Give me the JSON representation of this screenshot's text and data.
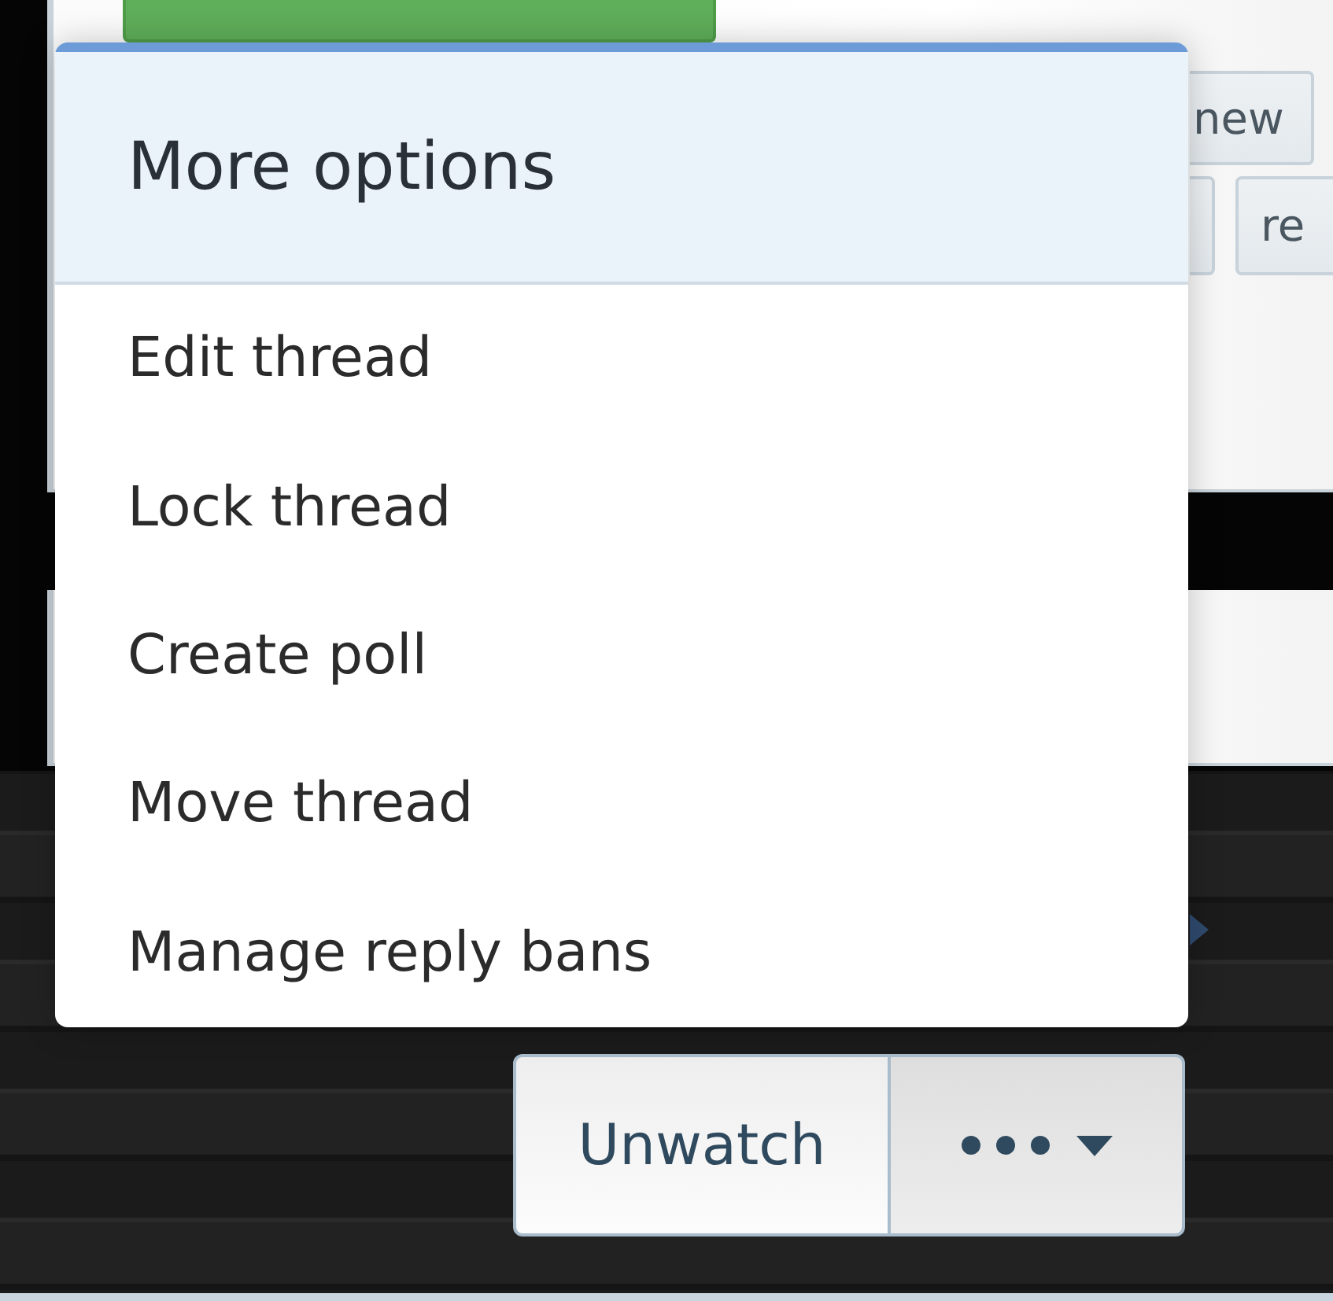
{
  "thread_tools": {
    "buttons": [
      {
        "label": "new"
      },
      {
        "label": "re"
      }
    ]
  },
  "watch_bar": {
    "buttons": [
      {
        "kind": "text",
        "label": "Unwatch"
      },
      {
        "kind": "menu",
        "expanded": true
      }
    ]
  },
  "menu": {
    "title": "More options",
    "items": [
      {
        "label": "Edit thread"
      },
      {
        "label": "Lock thread"
      },
      {
        "label": "Create poll"
      },
      {
        "label": "Move thread"
      },
      {
        "label": "Manage reply bans"
      }
    ]
  }
}
